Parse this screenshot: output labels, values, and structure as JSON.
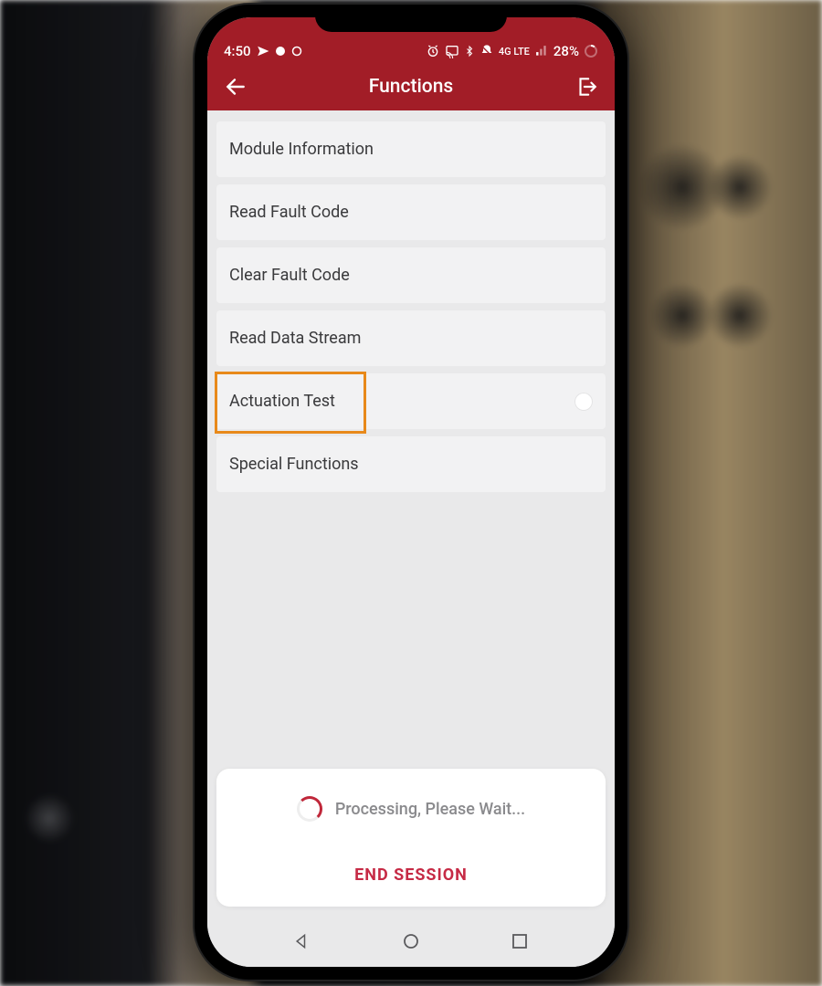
{
  "statusbar": {
    "time": "4:50",
    "network_label": "4G LTE",
    "battery_text": "28%"
  },
  "header": {
    "title": "Functions"
  },
  "functions": [
    {
      "label": "Module Information"
    },
    {
      "label": "Read Fault Code"
    },
    {
      "label": "Clear Fault Code"
    },
    {
      "label": "Read Data Stream"
    },
    {
      "label": "Actuation Test",
      "highlighted": true,
      "loading": true
    },
    {
      "label": "Special Functions"
    }
  ],
  "footer": {
    "processing_text": "Processing, Please Wait...",
    "end_session_label": "END SESSION"
  }
}
